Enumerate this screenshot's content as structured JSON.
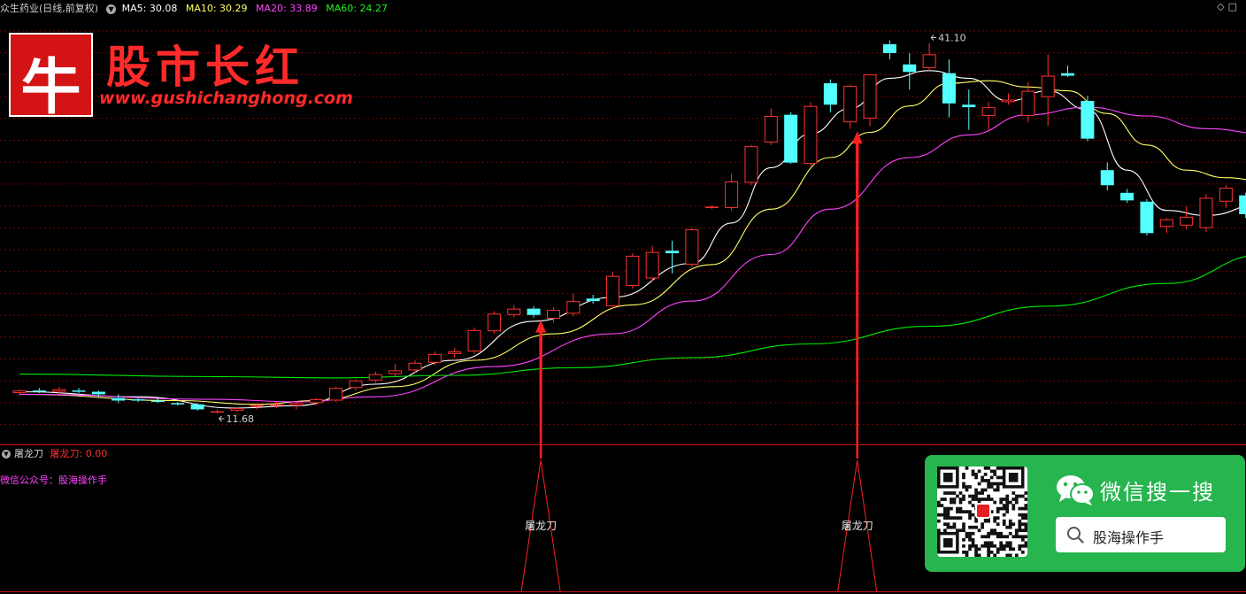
{
  "header": {
    "stock_name": "众生药业(日线,前复权)",
    "ma5_label": "MA5:",
    "ma5_value": "30.08",
    "ma10_label": "MA10:",
    "ma10_value": "30.29",
    "ma20_label": "MA20:",
    "ma20_value": "33.89",
    "ma60_label": "MA60:",
    "ma60_value": "24.27"
  },
  "watermark": {
    "logo_char": "牛",
    "brand": "股市长红",
    "site": "www.gushichanghong.com"
  },
  "indicator": {
    "name": "屠龙刀",
    "value_label": "屠龙刀: 0.00",
    "note": "微信公众号：股海操作手",
    "peak_label": "屠龙刀"
  },
  "wechat_card": {
    "title": "微信搜一搜",
    "query": "股海操作手"
  },
  "colors": {
    "up": "#ff3232",
    "down": "#54ffff",
    "ma5": "#ffffff",
    "ma10": "#ffff66",
    "ma20": "#ff44ff",
    "ma60": "#00ee00",
    "grid": "#7a0000",
    "signal": "#ff2020",
    "wechat": "#27b54f"
  },
  "chart_data": {
    "type": "candlestick",
    "price_range": [
      9.5,
      43.6
    ],
    "annotations": [
      {
        "label": "41.10",
        "index": 46,
        "value": 41.1,
        "kind": "high"
      },
      {
        "label": "11.68",
        "index": 10,
        "value": 11.68,
        "kind": "low"
      }
    ],
    "candles": [
      [
        13.3,
        13.6,
        13.1,
        13.5
      ],
      [
        13.5,
        13.7,
        13.3,
        13.4
      ],
      [
        13.4,
        13.8,
        13.2,
        13.6
      ],
      [
        13.5,
        13.7,
        13.3,
        13.4
      ],
      [
        13.4,
        13.5,
        13.0,
        13.2
      ],
      [
        12.9,
        13.2,
        12.5,
        12.7
      ],
      [
        12.8,
        12.9,
        12.6,
        12.7
      ],
      [
        12.7,
        12.9,
        12.5,
        12.6
      ],
      [
        12.5,
        12.6,
        12.3,
        12.4
      ],
      [
        12.4,
        12.5,
        11.9,
        12.0
      ],
      [
        11.8,
        12.0,
        11.68,
        11.85
      ],
      [
        11.9,
        12.2,
        11.8,
        12.1
      ],
      [
        12.2,
        12.5,
        12.0,
        12.35
      ],
      [
        12.3,
        12.6,
        12.1,
        12.4
      ],
      [
        12.3,
        12.6,
        12.0,
        12.5
      ],
      [
        12.5,
        12.9,
        12.3,
        12.8
      ],
      [
        12.7,
        13.8,
        12.6,
        13.7
      ],
      [
        13.7,
        14.4,
        13.5,
        14.3
      ],
      [
        14.3,
        15.0,
        14.1,
        14.8
      ],
      [
        14.8,
        15.6,
        14.6,
        15.1
      ],
      [
        15.1,
        15.9,
        14.9,
        15.7
      ],
      [
        15.7,
        16.6,
        15.5,
        16.4
      ],
      [
        16.4,
        16.9,
        16.1,
        16.6
      ],
      [
        16.6,
        18.5,
        16.4,
        18.3
      ],
      [
        18.2,
        19.8,
        18.0,
        19.6
      ],
      [
        19.5,
        20.3,
        19.3,
        20.0
      ],
      [
        20.0,
        20.2,
        19.3,
        19.5
      ],
      [
        19.2,
        20.1,
        18.9,
        19.9
      ],
      [
        19.6,
        21.2,
        19.4,
        20.6
      ],
      [
        20.8,
        21.1,
        20.4,
        20.6
      ],
      [
        20.2,
        22.9,
        20.0,
        22.6
      ],
      [
        21.8,
        24.4,
        21.6,
        24.2
      ],
      [
        22.4,
        25.0,
        22.2,
        24.5
      ],
      [
        24.6,
        25.4,
        22.8,
        24.4
      ],
      [
        23.5,
        26.4,
        23.3,
        26.3
      ],
      [
        28.0,
        28.2,
        27.9,
        28.1
      ],
      [
        28.0,
        30.7,
        27.8,
        30.1
      ],
      [
        30.0,
        33.0,
        29.8,
        32.9
      ],
      [
        33.2,
        35.9,
        33.0,
        35.3
      ],
      [
        35.4,
        35.6,
        31.5,
        31.6
      ],
      [
        31.5,
        36.4,
        31.3,
        36.1
      ],
      [
        37.9,
        38.2,
        35.6,
        36.2
      ],
      [
        34.8,
        37.8,
        34.3,
        37.7
      ],
      [
        35.1,
        38.6,
        34.5,
        38.6
      ],
      [
        41.0,
        41.3,
        39.8,
        40.3
      ],
      [
        39.4,
        40.3,
        37.4,
        38.8
      ],
      [
        39.1,
        41.1,
        38.9,
        40.2
      ],
      [
        38.7,
        39.8,
        35.2,
        36.3
      ],
      [
        36.2,
        37.4,
        34.2,
        36.0
      ],
      [
        35.3,
        36.4,
        34.1,
        36.0
      ],
      [
        36.4,
        37.1,
        36.2,
        36.6
      ],
      [
        35.3,
        38.0,
        34.8,
        37.3
      ],
      [
        36.8,
        40.2,
        34.5,
        38.5
      ],
      [
        38.7,
        39.3,
        38.4,
        38.5
      ],
      [
        36.5,
        36.9,
        33.3,
        33.5
      ],
      [
        31.0,
        31.6,
        29.4,
        29.8
      ],
      [
        29.2,
        29.5,
        28.4,
        28.6
      ],
      [
        28.5,
        28.7,
        25.8,
        26.0
      ],
      [
        26.5,
        27.2,
        26.0,
        27.1
      ],
      [
        26.6,
        28.1,
        26.3,
        27.3
      ],
      [
        26.4,
        29.1,
        26.1,
        28.8
      ],
      [
        28.5,
        29.8,
        28.0,
        29.6
      ],
      [
        29.0,
        29.2,
        27.2,
        27.5
      ],
      [
        28.2,
        29.8,
        27.7,
        28.0
      ]
    ],
    "ma_series": [
      {
        "name": "MA5",
        "points": [
          [
            0,
            13.4
          ],
          [
            6,
            13.0
          ],
          [
            11,
            12.1
          ],
          [
            14,
            12.3
          ],
          [
            18,
            14.0
          ],
          [
            22,
            15.9
          ],
          [
            26,
            19.0
          ],
          [
            30,
            20.9
          ],
          [
            34,
            23.6
          ],
          [
            36,
            26.8
          ],
          [
            38,
            31.2
          ],
          [
            40,
            33.9
          ],
          [
            42,
            35.9
          ],
          [
            44,
            38.3
          ],
          [
            46,
            38.9
          ],
          [
            48,
            38.3
          ],
          [
            50,
            36.5
          ],
          [
            52,
            37.3
          ],
          [
            54,
            35.8
          ],
          [
            56,
            31.0
          ],
          [
            58,
            27.8
          ],
          [
            60,
            27.4
          ],
          [
            63,
            28.4
          ]
        ]
      },
      {
        "name": "MA10",
        "points": [
          [
            0,
            13.2
          ],
          [
            8,
            12.7
          ],
          [
            12,
            12.4
          ],
          [
            15,
            12.7
          ],
          [
            19,
            13.8
          ],
          [
            23,
            15.9
          ],
          [
            27,
            18.0
          ],
          [
            31,
            20.3
          ],
          [
            35,
            23.5
          ],
          [
            38,
            27.9
          ],
          [
            41,
            32.0
          ],
          [
            43,
            34.0
          ],
          [
            45,
            36.1
          ],
          [
            47,
            37.9
          ],
          [
            49,
            38.1
          ],
          [
            51,
            37.6
          ],
          [
            53,
            37.3
          ],
          [
            55,
            35.5
          ],
          [
            57,
            33.0
          ],
          [
            59,
            31.0
          ],
          [
            61,
            30.4
          ],
          [
            63,
            30.1
          ]
        ]
      },
      {
        "name": "MA20",
        "points": [
          [
            0,
            13.2
          ],
          [
            10,
            12.8
          ],
          [
            14,
            12.6
          ],
          [
            18,
            13.0
          ],
          [
            24,
            15.4
          ],
          [
            30,
            18.0
          ],
          [
            34,
            20.6
          ],
          [
            38,
            24.3
          ],
          [
            41,
            27.9
          ],
          [
            45,
            32.0
          ],
          [
            48,
            33.8
          ],
          [
            51,
            35.4
          ],
          [
            54,
            36.0
          ],
          [
            57,
            35.3
          ],
          [
            60,
            34.3
          ],
          [
            63,
            33.9
          ]
        ]
      },
      {
        "name": "MA60",
        "points": [
          [
            0,
            14.8
          ],
          [
            10,
            14.6
          ],
          [
            16,
            14.5
          ],
          [
            22,
            14.7
          ],
          [
            28,
            15.3
          ],
          [
            34,
            16.1
          ],
          [
            40,
            17.2
          ],
          [
            46,
            18.6
          ],
          [
            52,
            20.2
          ],
          [
            58,
            22.0
          ],
          [
            63,
            24.3
          ]
        ]
      }
    ],
    "signals": [
      {
        "label": "屠龙刀",
        "index": 26
      },
      {
        "label": "屠龙刀",
        "index": 42
      }
    ]
  }
}
